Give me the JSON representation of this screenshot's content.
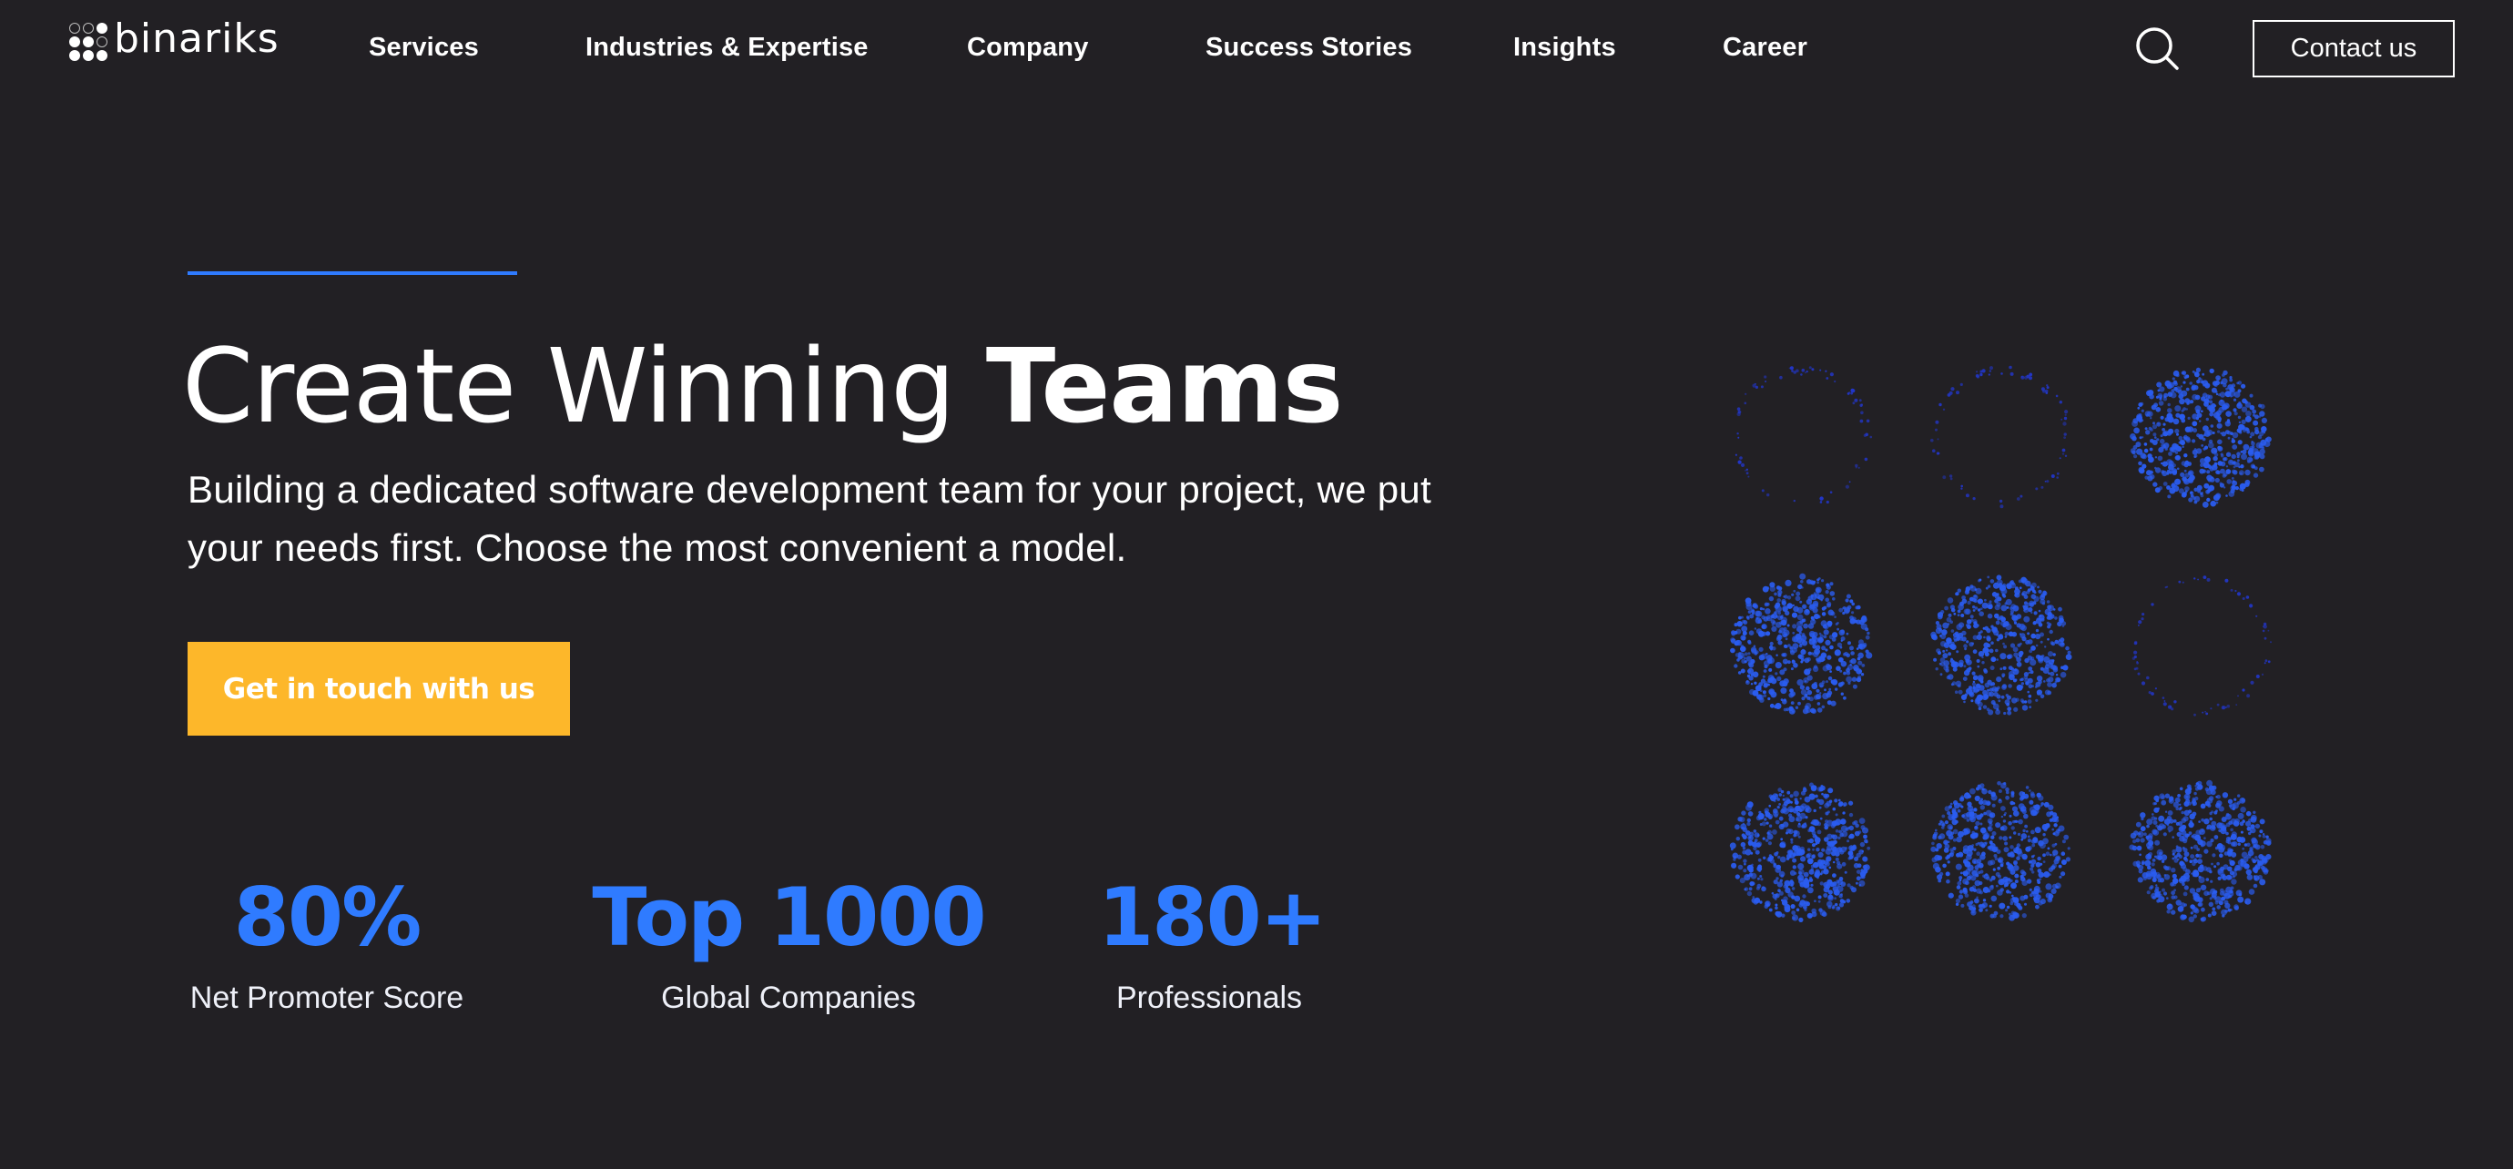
{
  "header": {
    "logo_text": "binariks",
    "logo_dots": [
      [
        "hollow",
        "hollow",
        "filled"
      ],
      [
        "filled",
        "filled",
        "hollow"
      ],
      [
        "filled",
        "filled",
        "filled"
      ]
    ],
    "nav": [
      {
        "label": "Services"
      },
      {
        "label": "Industries & Expertise"
      },
      {
        "label": "Company"
      },
      {
        "label": "Success Stories"
      },
      {
        "label": "Insights"
      },
      {
        "label": "Career"
      }
    ],
    "search_icon": "search-icon",
    "contact_label": "Contact us"
  },
  "hero": {
    "headline_light": "Create Winning ",
    "headline_bold": "Teams",
    "subtitle": "Building a dedicated software development team for your project, we put your needs first. Choose the most convenient a model.",
    "cta_label": "Get in touch with us",
    "stats": [
      {
        "value": "80%",
        "label": "Net Promoter Score"
      },
      {
        "value": "Top 1000",
        "label": "Global Companies"
      },
      {
        "value": "180+",
        "label": "Professionals"
      }
    ]
  },
  "dot_grid": {
    "cells": [
      [
        "ring",
        "ring",
        "filled"
      ],
      [
        "filled",
        "filled",
        "ring"
      ],
      [
        "filled",
        "filled",
        "filled"
      ]
    ]
  },
  "colors": {
    "background": "#222024",
    "accent_blue": "#2f7bff",
    "cta_yellow": "#fdb72a",
    "particle_blue": "#2a5cf0",
    "ring_blue": "#2236c8"
  }
}
